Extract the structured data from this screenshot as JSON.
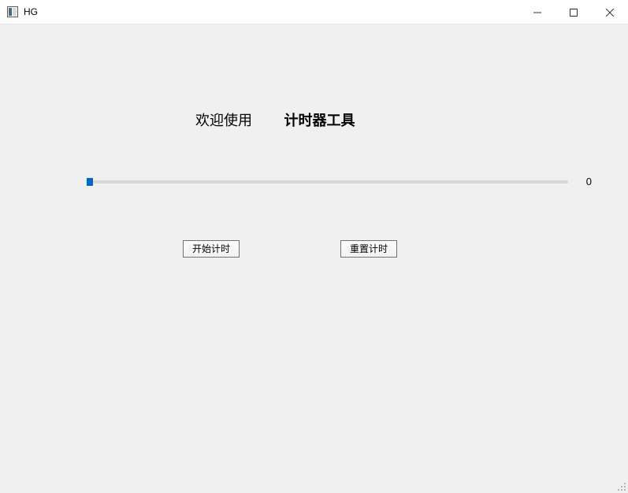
{
  "window": {
    "title": "HG"
  },
  "heading": {
    "welcome": "欢迎使用",
    "tool": "计时器工具"
  },
  "progress": {
    "value_label": "0"
  },
  "buttons": {
    "start": "开始计时",
    "reset": "重置计时"
  }
}
